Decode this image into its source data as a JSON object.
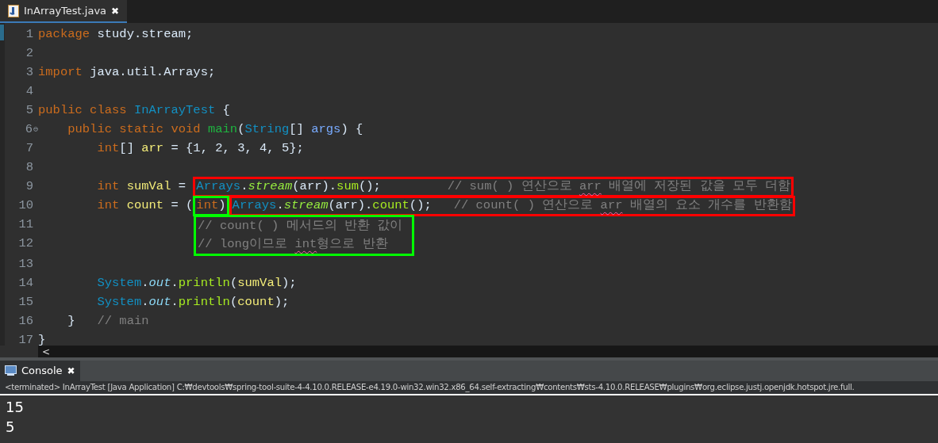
{
  "editor_tab": {
    "title": "InArrayTest.java",
    "selected": true,
    "close": "✖"
  },
  "code": [
    {
      "kind": "line",
      "number": "1",
      "segments": [
        {
          "tokens": [
            {
              "t": "package ",
              "kind": "kw"
            },
            {
              "t": "study.stream;",
              "kind": "plain"
            }
          ]
        }
      ]
    },
    {
      "kind": "line",
      "number": "2"
    },
    {
      "kind": "line",
      "number": "3",
      "segments": [
        {
          "tokens": [
            {
              "t": "import ",
              "kind": "kw"
            },
            {
              "t": "java.util.Arrays;",
              "kind": "plain"
            }
          ]
        }
      ]
    },
    {
      "kind": "line",
      "number": "4"
    },
    {
      "kind": "line",
      "number": "5",
      "segments": [
        {
          "tokens": [
            {
              "t": "public class ",
              "kind": "kw"
            },
            {
              "t": "InArrayTest ",
              "kind": "type"
            },
            {
              "t": "{",
              "kind": "plain"
            }
          ]
        }
      ]
    },
    {
      "kind": "line",
      "number": "6",
      "fold": "⊖",
      "segments": [
        {
          "tokens": [
            {
              "t": "    public static void ",
              "kind": "kw"
            },
            {
              "t": "main",
              "kind": "method_decl"
            },
            {
              "t": "(",
              "kind": "plain"
            },
            {
              "t": "String",
              "kind": "type"
            },
            {
              "t": "[] ",
              "kind": "plain"
            },
            {
              "t": "args",
              "kind": "param"
            },
            {
              "t": ") {",
              "kind": "plain"
            }
          ]
        }
      ]
    },
    {
      "kind": "line",
      "number": "7",
      "segments": [
        {
          "tokens": [
            {
              "t": "        int",
              "kind": "kw"
            },
            {
              "t": "[] ",
              "kind": "plain"
            },
            {
              "t": "arr",
              "kind": "local"
            },
            {
              "t": " = {1, 2, 3, 4, 5};",
              "kind": "plain"
            }
          ]
        }
      ]
    },
    {
      "kind": "line",
      "number": "8"
    },
    {
      "kind": "line",
      "number": "9",
      "segments": [
        {
          "tokens": [
            {
              "t": "        int ",
              "kind": "kw"
            },
            {
              "t": "sumVal",
              "kind": "local"
            },
            {
              "t": " = ",
              "kind": "plain"
            }
          ]
        },
        {
          "color": "#ff0000",
          "tokens": [
            {
              "t": "Arrays",
              "kind": "type"
            },
            {
              "t": ".",
              "kind": "plain"
            },
            {
              "t": "stream",
              "kind": "static_method"
            },
            {
              "t": "(arr).",
              "kind": "plain"
            },
            {
              "t": "sum",
              "kind": "method"
            },
            {
              "t": "();         ",
              "kind": "plain"
            },
            {
              "t": "// sum( ) 연산으로 ",
              "kind": "comment"
            },
            {
              "t": "arr",
              "kind": "comment",
              "misspelled": true
            },
            {
              "t": " 배열에 저장된 값을 모두 더함",
              "kind": "comment"
            }
          ]
        }
      ]
    },
    {
      "kind": "line",
      "number": "10",
      "segments": [
        {
          "tokens": [
            {
              "t": "        int ",
              "kind": "kw"
            },
            {
              "t": "count",
              "kind": "local"
            },
            {
              "t": " = (",
              "kind": "plain"
            }
          ]
        },
        {
          "color": "#00ff00",
          "tokens": [
            {
              "t": "int",
              "kind": "kw"
            },
            {
              "t": ")",
              "kind": "plain"
            }
          ]
        },
        {
          "color": "#ff0000",
          "tokens": [
            {
              "t": "Arrays",
              "kind": "type"
            },
            {
              "t": ".",
              "kind": "plain"
            },
            {
              "t": "stream",
              "kind": "static_method"
            },
            {
              "t": "(arr).",
              "kind": "plain"
            },
            {
              "t": "count",
              "kind": "method"
            },
            {
              "t": "();   ",
              "kind": "plain"
            },
            {
              "t": "// count( ) 연산으로 ",
              "kind": "comment"
            },
            {
              "t": "arr",
              "kind": "comment",
              "misspelled": true
            },
            {
              "t": " 배열의 요소 개수를 반환함",
              "kind": "comment"
            }
          ]
        }
      ]
    },
    {
      "kind": "group",
      "color": "#00ff00",
      "lines": [
        {
          "number": "11",
          "tokens": [
            {
              "t": "// count( ) 메서드의 반환 값이",
              "kind": "comment"
            }
          ]
        },
        {
          "number": "12",
          "tokens": [
            {
              "t": "// long이므로 ",
              "kind": "comment"
            },
            {
              "t": "int",
              "kind": "comment",
              "misspelled": true
            },
            {
              "t": "형으로 반환",
              "kind": "comment"
            }
          ]
        }
      ]
    },
    {
      "kind": "line",
      "number": "13"
    },
    {
      "kind": "line",
      "number": "14",
      "segments": [
        {
          "tokens": [
            {
              "t": "        System",
              "kind": "type"
            },
            {
              "t": ".",
              "kind": "plain"
            },
            {
              "t": "out",
              "kind": "static_field"
            },
            {
              "t": ".",
              "kind": "plain"
            },
            {
              "t": "println",
              "kind": "method"
            },
            {
              "t": "(",
              "kind": "plain"
            },
            {
              "t": "sumVal",
              "kind": "local"
            },
            {
              "t": ");",
              "kind": "plain"
            }
          ]
        }
      ]
    },
    {
      "kind": "line",
      "number": "15",
      "segments": [
        {
          "tokens": [
            {
              "t": "        System",
              "kind": "type"
            },
            {
              "t": ".",
              "kind": "plain"
            },
            {
              "t": "out",
              "kind": "static_field"
            },
            {
              "t": ".",
              "kind": "plain"
            },
            {
              "t": "println",
              "kind": "method"
            },
            {
              "t": "(",
              "kind": "plain"
            },
            {
              "t": "count",
              "kind": "local"
            },
            {
              "t": ");",
              "kind": "plain"
            }
          ]
        }
      ]
    },
    {
      "kind": "line",
      "number": "16",
      "segments": [
        {
          "tokens": [
            {
              "t": "    }   ",
              "kind": "plain"
            },
            {
              "t": "// main",
              "kind": "comment"
            }
          ]
        }
      ]
    },
    {
      "kind": "line",
      "number": "17",
      "segments": [
        {
          "tokens": [
            {
              "t": "}",
              "kind": "plain"
            }
          ]
        }
      ]
    }
  ],
  "scroll_left": "<",
  "console_tab": {
    "title": "Console",
    "selected": true,
    "close": "✖"
  },
  "console_status": "<terminated> InArrayTest [Java Application] C:₩devtools₩spring-tool-suite-4-4.10.0.RELEASE-e4.19.0-win32.win32.x86_64.self-extracting₩contents₩sts-4.10.0.RELEASE₩plugins₩org.eclipse.justj.openjdk.hotspot.jre.full.",
  "console_output": [
    "15",
    "5"
  ]
}
